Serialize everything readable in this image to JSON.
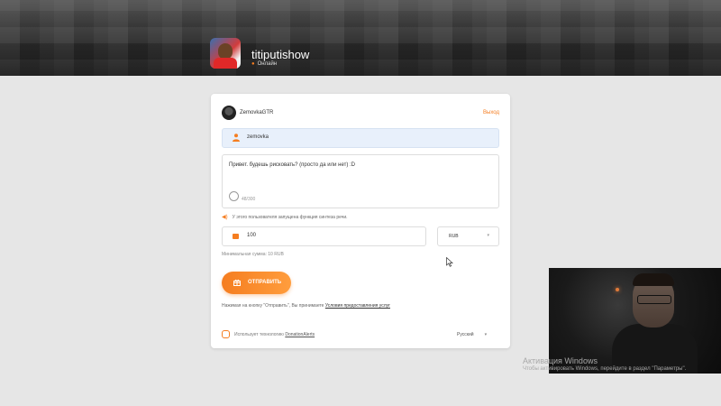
{
  "header": {
    "channel_name": "titiputishow",
    "status": "Онлайн"
  },
  "card": {
    "user_name": "ZemovkaGTR",
    "logout_label": "Выход",
    "name_value": "zemovka",
    "message_text": "Привет. будешь рисковать? (просто да или нет) :D",
    "char_count": "48/300",
    "tts_note": "У этого пользователя запущена функция синтеза речи.",
    "amount_value": "100",
    "currency_value": "RUB",
    "min_sum": "Минимальная сумма: 10 RUB",
    "send_label": "ОТПРАВИТЬ",
    "terms_prefix": "Нажимая на кнопку \"Отправить\", Вы принимаете",
    "terms_link": "Условия предоставления услуг",
    "footer_prefix": "Использует технологию",
    "footer_link": "DonationAlerts",
    "language": "Русский"
  },
  "os_overlay": {
    "title": "Активация Windows",
    "text": "Чтобы активировать Windows, перейдите в раздел \"Параметры\"."
  },
  "colors": {
    "accent": "#f57d20",
    "name_field_bg": "#e8f0fb",
    "page_bg": "#e6e6e6"
  }
}
